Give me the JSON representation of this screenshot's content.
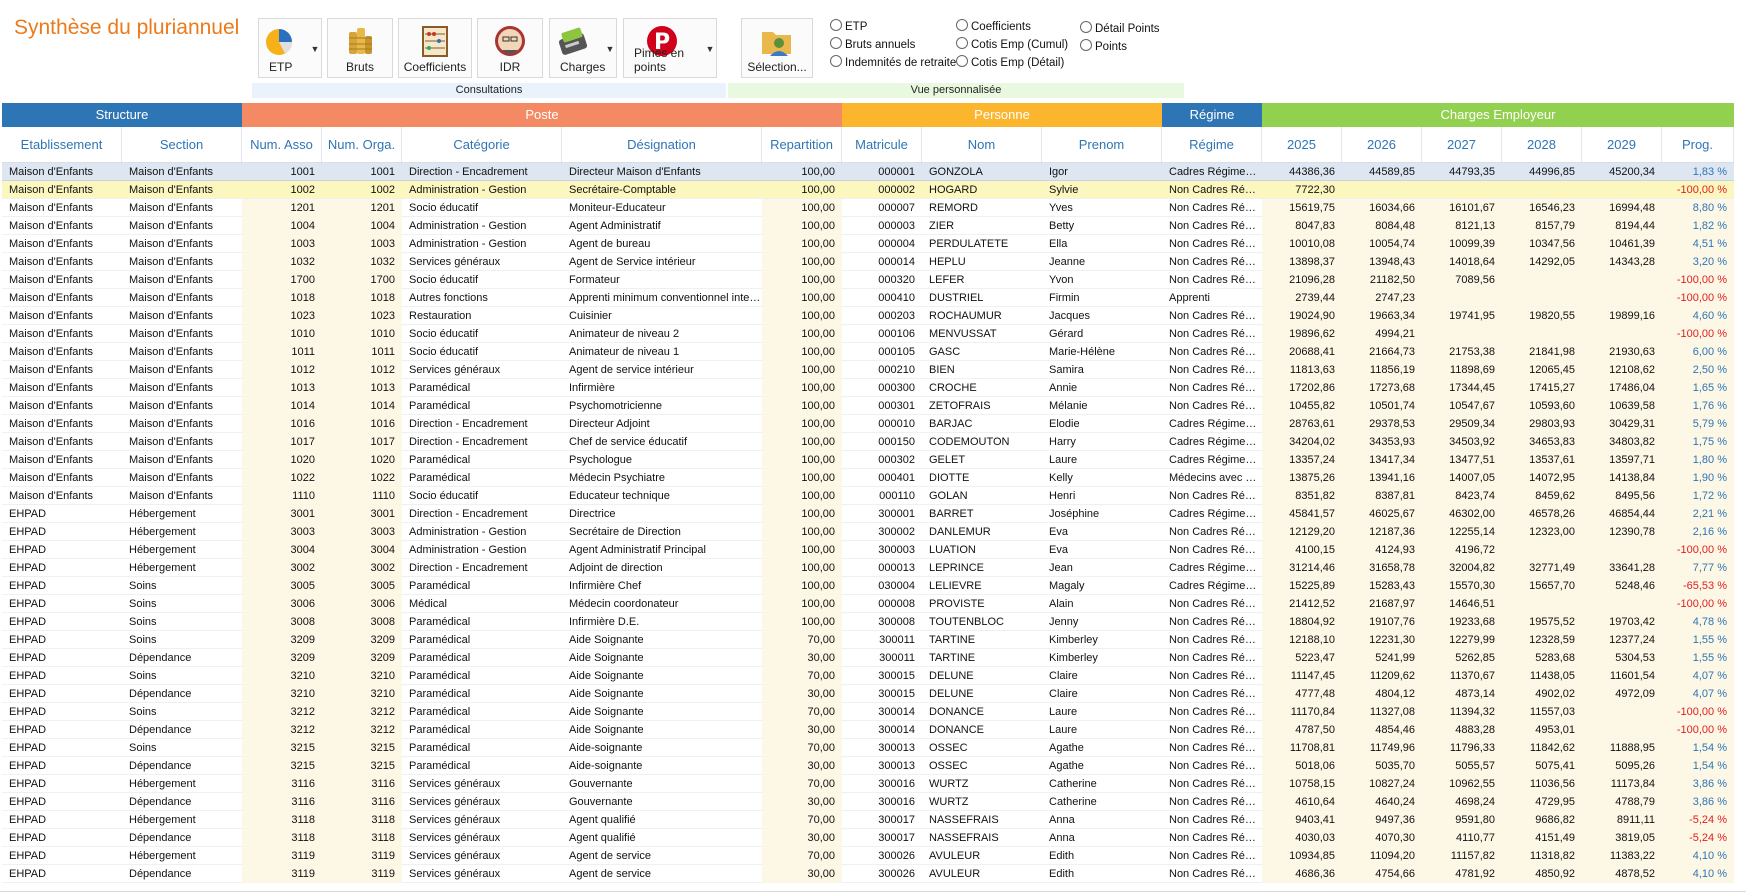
{
  "app": {
    "title": "Synthèse du pluriannuel"
  },
  "ribbon": {
    "buttons": [
      {
        "id": "etp",
        "label": "ETP",
        "icon": "pie-chart-icon",
        "dropdown": true
      },
      {
        "id": "bruts",
        "label": "Bruts",
        "icon": "coins-icon",
        "dropdown": false
      },
      {
        "id": "coeff",
        "label": "Coefficients",
        "icon": "abacus-icon",
        "dropdown": false
      },
      {
        "id": "idr",
        "label": "IDR",
        "icon": "retiree-portrait-icon",
        "dropdown": false
      },
      {
        "id": "charges",
        "label": "Charges",
        "icon": "card-terminal-icon",
        "dropdown": true
      },
      {
        "id": "primes",
        "label": "Pimes en points",
        "icon": "pinterest-p-icon",
        "dropdown": true
      },
      {
        "id": "selection",
        "label": "Sélection...",
        "icon": "user-folder-icon",
        "dropdown": false
      }
    ],
    "groups": {
      "consultations": "Consultations",
      "vue": "Vue personnalisée"
    },
    "radios": [
      "ETP",
      "Bruts annuels",
      "Indemnités de retraite",
      "Coefficients",
      "Cotis Emp (Cumul)",
      "Cotis Emp (Détail)",
      "Détail Points",
      "Points"
    ]
  },
  "bands": [
    {
      "label": "Structure",
      "color": "#2e75b6"
    },
    {
      "label": "Poste",
      "color": "#f48a63"
    },
    {
      "label": "Personne",
      "color": "#fbb62e"
    },
    {
      "label": "Régime",
      "color": "#2e75b6"
    },
    {
      "label": "Charges Employeur",
      "color": "#92d050"
    }
  ],
  "columns": [
    "Etablissement",
    "Section",
    "Num. Asso",
    "Num. Orga.",
    "Catégorie",
    "Désignation",
    "Repartition",
    "Matricule",
    "Nom",
    "Prenom",
    "Régime",
    "2025",
    "2026",
    "2027",
    "2028",
    "2029",
    "Prog."
  ],
  "rows": [
    [
      "Maison d'Enfants",
      "Maison d'Enfants",
      "1001",
      "1001",
      "Direction - Encadrement",
      "Directeur Maison d'Enfants",
      "100,00",
      "000001",
      "GONZOLA",
      "Igor",
      "Cadres Régime…",
      "44386,36",
      "44589,85",
      "44793,35",
      "44996,85",
      "45200,34",
      "1,83 %"
    ],
    [
      "Maison d'Enfants",
      "Maison d'Enfants",
      "1002",
      "1002",
      "Administration - Gestion",
      "Secrétaire-Comptable",
      "100,00",
      "000002",
      "HOGARD",
      "Sylvie",
      "Non Cadres Ré…",
      "7722,30",
      "",
      "",
      "",
      "",
      "-100,00 %"
    ],
    [
      "Maison d'Enfants",
      "Maison d'Enfants",
      "1201",
      "1201",
      "Socio éducatif",
      "Moniteur-Educateur",
      "100,00",
      "000007",
      "REMORD",
      "Yves",
      "Non Cadres Ré…",
      "15619,75",
      "16034,66",
      "16101,67",
      "16546,23",
      "16994,48",
      "8,80 %"
    ],
    [
      "Maison d'Enfants",
      "Maison d'Enfants",
      "1004",
      "1004",
      "Administration - Gestion",
      "Agent Administratif",
      "100,00",
      "000003",
      "ZIER",
      "Betty",
      "Non Cadres Ré…",
      "8047,83",
      "8084,48",
      "8121,13",
      "8157,79",
      "8194,44",
      "1,82 %"
    ],
    [
      "Maison d'Enfants",
      "Maison d'Enfants",
      "1003",
      "1003",
      "Administration - Gestion",
      "Agent de bureau",
      "100,00",
      "000004",
      "PERDULATETE",
      "Ella",
      "Non Cadres Ré…",
      "10010,08",
      "10054,74",
      "10099,39",
      "10347,56",
      "10461,39",
      "4,51 %"
    ],
    [
      "Maison d'Enfants",
      "Maison d'Enfants",
      "1032",
      "1032",
      "Services généraux",
      "Agent de Service intérieur",
      "100,00",
      "000014",
      "HEPLU",
      "Jeanne",
      "Non Cadres Ré…",
      "13898,37",
      "13948,43",
      "14018,64",
      "14292,05",
      "14343,28",
      "3,20 %"
    ],
    [
      "Maison d'Enfants",
      "Maison d'Enfants",
      "1700",
      "1700",
      "Socio éducatif",
      "Formateur",
      "100,00",
      "000320",
      "LEFER",
      "Yvon",
      "Non Cadres Ré…",
      "21096,28",
      "21182,50",
      "7089,56",
      "",
      "",
      "-100,00 %"
    ],
    [
      "Maison d'Enfants",
      "Maison d'Enfants",
      "1018",
      "1018",
      "Autres fonctions",
      "Apprenti minimum conventionnel inte…",
      "100,00",
      "000410",
      "DUSTRIEL",
      "Firmin",
      "Apprenti",
      "2739,44",
      "2747,23",
      "",
      "",
      "",
      "-100,00 %"
    ],
    [
      "Maison d'Enfants",
      "Maison d'Enfants",
      "1023",
      "1023",
      "Restauration",
      "Cuisinier",
      "100,00",
      "000203",
      "ROCHAUMUR",
      "Jacques",
      "Non Cadres Ré…",
      "19024,90",
      "19663,34",
      "19741,95",
      "19820,55",
      "19899,16",
      "4,60 %"
    ],
    [
      "Maison d'Enfants",
      "Maison d'Enfants",
      "1010",
      "1010",
      "Socio éducatif",
      "Animateur de niveau 2",
      "100,00",
      "000106",
      "MENVUSSAT",
      "Gérard",
      "Non Cadres Ré…",
      "19896,62",
      "4994,21",
      "",
      "",
      "",
      "-100,00 %"
    ],
    [
      "Maison d'Enfants",
      "Maison d'Enfants",
      "1011",
      "1011",
      "Socio éducatif",
      "Animateur de niveau 1",
      "100,00",
      "000105",
      "GASC",
      "Marie-Hélène",
      "Non Cadres Ré…",
      "20688,41",
      "21664,73",
      "21753,38",
      "21841,98",
      "21930,63",
      "6,00 %"
    ],
    [
      "Maison d'Enfants",
      "Maison d'Enfants",
      "1012",
      "1012",
      "Services généraux",
      "Agent de service intérieur",
      "100,00",
      "000210",
      "BIEN",
      "Samira",
      "Non Cadres Ré…",
      "11813,63",
      "11856,19",
      "11898,69",
      "12065,45",
      "12108,62",
      "2,50 %"
    ],
    [
      "Maison d'Enfants",
      "Maison d'Enfants",
      "1013",
      "1013",
      "Paramédical",
      "Infirmière",
      "100,00",
      "000300",
      "CROCHE",
      "Annie",
      "Non Cadres Ré…",
      "17202,86",
      "17273,68",
      "17344,45",
      "17415,27",
      "17486,04",
      "1,65 %"
    ],
    [
      "Maison d'Enfants",
      "Maison d'Enfants",
      "1014",
      "1014",
      "Paramédical",
      "Psychomotricienne",
      "100,00",
      "000301",
      "ZETOFRAIS",
      "Mélanie",
      "Non Cadres Ré…",
      "10455,82",
      "10501,74",
      "10547,67",
      "10593,60",
      "10639,58",
      "1,76 %"
    ],
    [
      "Maison d'Enfants",
      "Maison d'Enfants",
      "1016",
      "1016",
      "Direction - Encadrement",
      "Directeur Adjoint",
      "100,00",
      "000010",
      "BARJAC",
      "Elodie",
      "Cadres Régime…",
      "28763,61",
      "29378,53",
      "29509,34",
      "29803,93",
      "30429,31",
      "5,79 %"
    ],
    [
      "Maison d'Enfants",
      "Maison d'Enfants",
      "1017",
      "1017",
      "Direction - Encadrement",
      "Chef de service éducatif",
      "100,00",
      "000150",
      "CODEMOUTON",
      "Harry",
      "Cadres Régime…",
      "34204,02",
      "34353,93",
      "34503,92",
      "34653,83",
      "34803,82",
      "1,75 %"
    ],
    [
      "Maison d'Enfants",
      "Maison d'Enfants",
      "1020",
      "1020",
      "Paramédical",
      "Psychologue",
      "100,00",
      "000302",
      "GELET",
      "Laure",
      "Cadres Régime…",
      "13357,24",
      "13417,34",
      "13477,51",
      "13537,61",
      "13597,71",
      "1,80 %"
    ],
    [
      "Maison d'Enfants",
      "Maison d'Enfants",
      "1022",
      "1022",
      "Paramédical",
      "Médecin Psychiatre",
      "100,00",
      "000401",
      "DIOTTE",
      "Kelly",
      "Médecins avec …",
      "13875,26",
      "13941,16",
      "14007,05",
      "14072,95",
      "14138,84",
      "1,90 %"
    ],
    [
      "Maison d'Enfants",
      "Maison d'Enfants",
      "1110",
      "1110",
      "Socio éducatif",
      "Educateur technique",
      "100,00",
      "000110",
      "GOLAN",
      "Henri",
      "Non Cadres Ré…",
      "8351,82",
      "8387,81",
      "8423,74",
      "8459,62",
      "8495,56",
      "1,72 %"
    ],
    [
      "EHPAD",
      "Hébergement",
      "3001",
      "3001",
      "Direction - Encadrement",
      "Directrice",
      "100,00",
      "300001",
      "BARRET",
      "Joséphine",
      "Cadres Régime…",
      "45841,57",
      "46025,67",
      "46302,00",
      "46578,26",
      "46854,44",
      "2,21 %"
    ],
    [
      "EHPAD",
      "Hébergement",
      "3003",
      "3003",
      "Administration - Gestion",
      "Secrétaire de Direction",
      "100,00",
      "300002",
      "DANLEMUR",
      "Eva",
      "Non Cadres Ré…",
      "12129,20",
      "12187,36",
      "12255,14",
      "12323,00",
      "12390,78",
      "2,16 %"
    ],
    [
      "EHPAD",
      "Hébergement",
      "3004",
      "3004",
      "Administration - Gestion",
      "Agent Administratif Principal",
      "100,00",
      "300003",
      "LUATION",
      "Eva",
      "Non Cadres Ré…",
      "4100,15",
      "4124,93",
      "4196,72",
      "",
      "",
      "-100,00 %"
    ],
    [
      "EHPAD",
      "Hébergement",
      "3002",
      "3002",
      "Direction - Encadrement",
      "Adjoint de direction",
      "100,00",
      "000013",
      "LEPRINCE",
      "Jean",
      "Cadres Régime…",
      "31214,46",
      "31658,78",
      "32004,82",
      "32771,49",
      "33641,28",
      "7,77 %"
    ],
    [
      "EHPAD",
      "Soins",
      "3005",
      "3005",
      "Paramédical",
      "Infirmière Chef",
      "100,00",
      "030004",
      "LELIEVRE",
      "Magaly",
      "Cadres Régime…",
      "15225,89",
      "15283,43",
      "15570,30",
      "15657,70",
      "5248,46",
      "-65,53 %"
    ],
    [
      "EHPAD",
      "Soins",
      "3006",
      "3006",
      "Médical",
      "Médecin coordonateur",
      "100,00",
      "000008",
      "PROVISTE",
      "Alain",
      "Non Cadres Ré…",
      "21412,52",
      "21687,97",
      "14646,51",
      "",
      "",
      "-100,00 %"
    ],
    [
      "EHPAD",
      "Soins",
      "3008",
      "3008",
      "Paramédical",
      "Infirmière D.E.",
      "100,00",
      "300008",
      "TOUTENBLOC",
      "Jenny",
      "Non Cadres Ré…",
      "18804,92",
      "19107,76",
      "19233,68",
      "19575,52",
      "19703,42",
      "4,78 %"
    ],
    [
      "EHPAD",
      "Soins",
      "3209",
      "3209",
      "Paramédical",
      "Aide Soignante",
      "70,00",
      "300011",
      "TARTINE",
      "Kimberley",
      "Non Cadres Ré…",
      "12188,10",
      "12231,30",
      "12279,99",
      "12328,59",
      "12377,24",
      "1,55 %"
    ],
    [
      "EHPAD",
      "Dépendance",
      "3209",
      "3209",
      "Paramédical",
      "Aide Soignante",
      "30,00",
      "300011",
      "TARTINE",
      "Kimberley",
      "Non Cadres Ré…",
      "5223,47",
      "5241,99",
      "5262,85",
      "5283,68",
      "5304,53",
      "1,55 %"
    ],
    [
      "EHPAD",
      "Soins",
      "3210",
      "3210",
      "Paramédical",
      "Aide Soignante",
      "70,00",
      "300015",
      "DELUNE",
      "Claire",
      "Non Cadres Ré…",
      "11147,45",
      "11209,62",
      "11370,67",
      "11438,05",
      "11601,54",
      "4,07 %"
    ],
    [
      "EHPAD",
      "Dépendance",
      "3210",
      "3210",
      "Paramédical",
      "Aide Soignante",
      "30,00",
      "300015",
      "DELUNE",
      "Claire",
      "Non Cadres Ré…",
      "4777,48",
      "4804,12",
      "4873,14",
      "4902,02",
      "4972,09",
      "4,07 %"
    ],
    [
      "EHPAD",
      "Soins",
      "3212",
      "3212",
      "Paramédical",
      "Aide Soignante",
      "70,00",
      "300014",
      "DONANCE",
      "Laure",
      "Non Cadres Ré…",
      "11170,84",
      "11327,08",
      "11394,32",
      "11557,03",
      "",
      "-100,00 %"
    ],
    [
      "EHPAD",
      "Dépendance",
      "3212",
      "3212",
      "Paramédical",
      "Aide Soignante",
      "30,00",
      "300014",
      "DONANCE",
      "Laure",
      "Non Cadres Ré…",
      "4787,50",
      "4854,46",
      "4883,28",
      "4953,01",
      "",
      "-100,00 %"
    ],
    [
      "EHPAD",
      "Soins",
      "3215",
      "3215",
      "Paramédical",
      "Aide-soignante",
      "70,00",
      "300013",
      "OSSEC",
      "Agathe",
      "Non Cadres Ré…",
      "11708,81",
      "11749,96",
      "11796,33",
      "11842,62",
      "11888,95",
      "1,54 %"
    ],
    [
      "EHPAD",
      "Dépendance",
      "3215",
      "3215",
      "Paramédical",
      "Aide-soignante",
      "30,00",
      "300013",
      "OSSEC",
      "Agathe",
      "Non Cadres Ré…",
      "5018,06",
      "5035,70",
      "5055,57",
      "5075,41",
      "5095,26",
      "1,54 %"
    ],
    [
      "EHPAD",
      "Hébergement",
      "3116",
      "3116",
      "Services généraux",
      "Gouvernante",
      "70,00",
      "300016",
      "WURTZ",
      "Catherine",
      "Non Cadres Ré…",
      "10758,15",
      "10827,24",
      "10962,55",
      "11036,56",
      "11173,84",
      "3,86 %"
    ],
    [
      "EHPAD",
      "Dépendance",
      "3116",
      "3116",
      "Services généraux",
      "Gouvernante",
      "30,00",
      "300016",
      "WURTZ",
      "Catherine",
      "Non Cadres Ré…",
      "4610,64",
      "4640,24",
      "4698,24",
      "4729,95",
      "4788,79",
      "3,86 %"
    ],
    [
      "EHPAD",
      "Hébergement",
      "3118",
      "3118",
      "Services généraux",
      "Agent qualifié",
      "70,00",
      "300017",
      "NASSEFRAIS",
      "Anna",
      "Non Cadres Ré…",
      "9403,41",
      "9497,36",
      "9591,80",
      "9686,82",
      "8911,11",
      "-5,24 %"
    ],
    [
      "EHPAD",
      "Dépendance",
      "3118",
      "3118",
      "Services généraux",
      "Agent qualifié",
      "30,00",
      "300017",
      "NASSEFRAIS",
      "Anna",
      "Non Cadres Ré…",
      "4030,03",
      "4070,30",
      "4110,77",
      "4151,49",
      "3819,05",
      "-5,24 %"
    ],
    [
      "EHPAD",
      "Hébergement",
      "3119",
      "3119",
      "Services généraux",
      "Agent de service",
      "70,00",
      "300026",
      "AVULEUR",
      "Edith",
      "Non Cadres Ré…",
      "10934,85",
      "11094,20",
      "11157,82",
      "11318,82",
      "11383,22",
      "4,10 %"
    ],
    [
      "EHPAD",
      "Dépendance",
      "3119",
      "3119",
      "Services généraux",
      "Agent de service",
      "30,00",
      "300026",
      "AVULEUR",
      "Edith",
      "Non Cadres Ré…",
      "4686,36",
      "4754,66",
      "4781,92",
      "4850,92",
      "4878,52",
      "4,10 %"
    ]
  ],
  "selected_row": 0,
  "highlighted_row": 1,
  "colors": {
    "positive": "#2e75b6",
    "negative": "#e02020",
    "title": "#ec7a1b"
  }
}
